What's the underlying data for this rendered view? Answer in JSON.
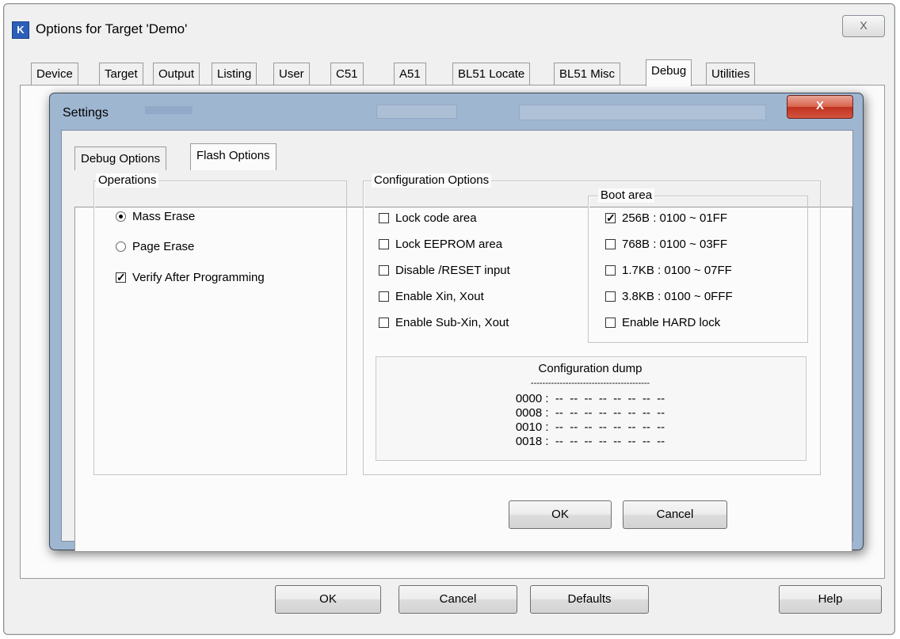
{
  "outer": {
    "app_icon": "K",
    "title": "Options for Target 'Demo'",
    "close_glyph": "X",
    "tabs": [
      "Device",
      "Target",
      "Output",
      "Listing",
      "User",
      "C51",
      "A51",
      "BL51 Locate",
      "BL51 Misc",
      "Debug",
      "Utilities"
    ],
    "active_tab": "Debug",
    "buttons": {
      "ok": "OK",
      "cancel": "Cancel",
      "defaults": "Defaults",
      "help": "Help"
    }
  },
  "settings": {
    "title": "Settings",
    "close_glyph": "X",
    "tabs": [
      "Debug Options",
      "Flash Options"
    ],
    "active_tab": "Flash Options",
    "operations": {
      "legend": "Operations",
      "mass_erase": {
        "label": "Mass Erase",
        "selected": true
      },
      "page_erase": {
        "label": "Page Erase",
        "selected": false
      },
      "verify": {
        "label": "Verify After Programming",
        "checked": true
      }
    },
    "config": {
      "legend": "Configuration Options",
      "items": [
        {
          "label": "Lock code area",
          "checked": false
        },
        {
          "label": "Lock EEPROM area",
          "checked": false
        },
        {
          "label": "Disable /RESET input",
          "checked": false
        },
        {
          "label": "Enable Xin, Xout",
          "checked": false
        },
        {
          "label": "Enable Sub-Xin, Xout",
          "checked": false
        }
      ]
    },
    "boot_area": {
      "legend": "Boot area",
      "items": [
        {
          "label": "256B : 0100 ~ 01FF",
          "checked": true
        },
        {
          "label": "768B : 0100 ~ 03FF",
          "checked": false
        },
        {
          "label": "1.7KB : 0100 ~ 07FF",
          "checked": false
        },
        {
          "label": "3.8KB : 0100 ~ 0FFF",
          "checked": false
        },
        {
          "label": "Enable HARD lock",
          "checked": false
        }
      ]
    },
    "dump": {
      "title": "Configuration dump",
      "separator": "-----------------------------------------",
      "lines": [
        "0000 :  --  --  --  --  --  --  --  --",
        "0008 :  --  --  --  --  --  --  --  --",
        "0010 :  --  --  --  --  --  --  --  --",
        "0018 :  --  --  --  --  --  --  --  --"
      ]
    },
    "buttons": {
      "ok": "OK",
      "cancel": "Cancel"
    }
  }
}
